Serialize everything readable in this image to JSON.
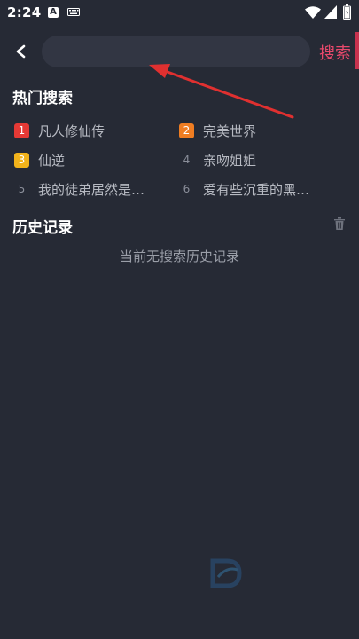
{
  "status_bar": {
    "time": "2:24",
    "app_icon_letter": "A"
  },
  "header": {
    "search_placeholder": "",
    "search_value": "",
    "search_button_label": "搜索"
  },
  "hot_search": {
    "title": "热门搜索",
    "items": [
      {
        "rank": "1",
        "label": "凡人修仙传",
        "badge_color": "#e53935"
      },
      {
        "rank": "2",
        "label": "完美世界",
        "badge_color": "#ef7d22"
      },
      {
        "rank": "3",
        "label": "仙逆",
        "badge_color": "#f2b31b"
      },
      {
        "rank": "4",
        "label": "亲吻姐姐",
        "badge_color": ""
      },
      {
        "rank": "5",
        "label": "我的徒弟居然是…",
        "badge_color": ""
      },
      {
        "rank": "6",
        "label": "爱有些沉重的黑…",
        "badge_color": ""
      }
    ]
  },
  "history": {
    "title": "历史记录",
    "empty_text": "当前无搜索历史记录"
  },
  "colors": {
    "background": "#262a35",
    "search_field": "#323643",
    "accent": "#e8496c",
    "annotation_arrow": "#e03030"
  },
  "icons": {
    "back": "chevron-left-icon",
    "trash": "trash-icon",
    "wifi": "wifi-icon",
    "signal": "signal-icon",
    "battery": "battery-icon",
    "keyboard": "keyboard-icon"
  }
}
